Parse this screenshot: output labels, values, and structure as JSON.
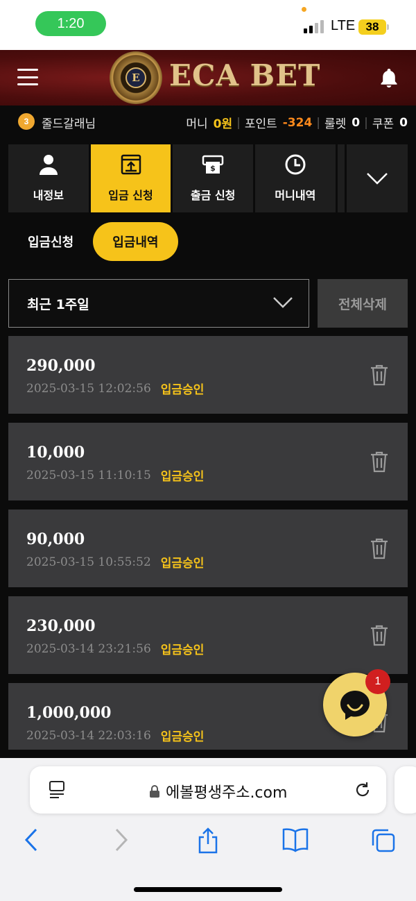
{
  "status_bar": {
    "time": "1:20",
    "network": "LTE",
    "battery": "38"
  },
  "header": {
    "logo_emblem_letter": "E",
    "logo_text": "ECA BET"
  },
  "user_bar": {
    "level": "3",
    "username": "줄드갈래님",
    "money_label": "머니",
    "money_value": "0원",
    "point_label": "포인트",
    "point_value": "-324",
    "roulette_label": "룰렛",
    "roulette_value": "0",
    "coupon_label": "쿠폰",
    "coupon_value": "0"
  },
  "nav_tabs": [
    {
      "label": "내정보",
      "icon": "user-icon",
      "active": false
    },
    {
      "label": "입금 신청",
      "icon": "deposit-icon",
      "active": true
    },
    {
      "label": "출금 신청",
      "icon": "withdraw-icon",
      "active": false
    },
    {
      "label": "머니내역",
      "icon": "clock-icon",
      "active": false
    }
  ],
  "sub_tabs": [
    {
      "label": "입금신청",
      "active": false
    },
    {
      "label": "입금내역",
      "active": true
    }
  ],
  "filter": {
    "period_selected": "최근 1주일",
    "delete_all_label": "전체삭제"
  },
  "deposits": [
    {
      "amount": "290,000",
      "datetime": "2025-03-15 12:02:56",
      "status": "입금승인"
    },
    {
      "amount": "10,000",
      "datetime": "2025-03-15 11:10:15",
      "status": "입금승인"
    },
    {
      "amount": "90,000",
      "datetime": "2025-03-15 10:55:52",
      "status": "입금승인"
    },
    {
      "amount": "230,000",
      "datetime": "2025-03-14 23:21:56",
      "status": "입금승인"
    },
    {
      "amount": "1,000,000",
      "datetime": "2025-03-14 22:03:16",
      "status": "입금승인"
    }
  ],
  "chat": {
    "badge_count": "1"
  },
  "browser": {
    "url": "에볼평생주소.com"
  },
  "colors": {
    "accent": "#f6c31a",
    "point_orange": "#ff8a1c",
    "card_bg": "#3a3a3c",
    "header_red": "#5a0f0f"
  }
}
